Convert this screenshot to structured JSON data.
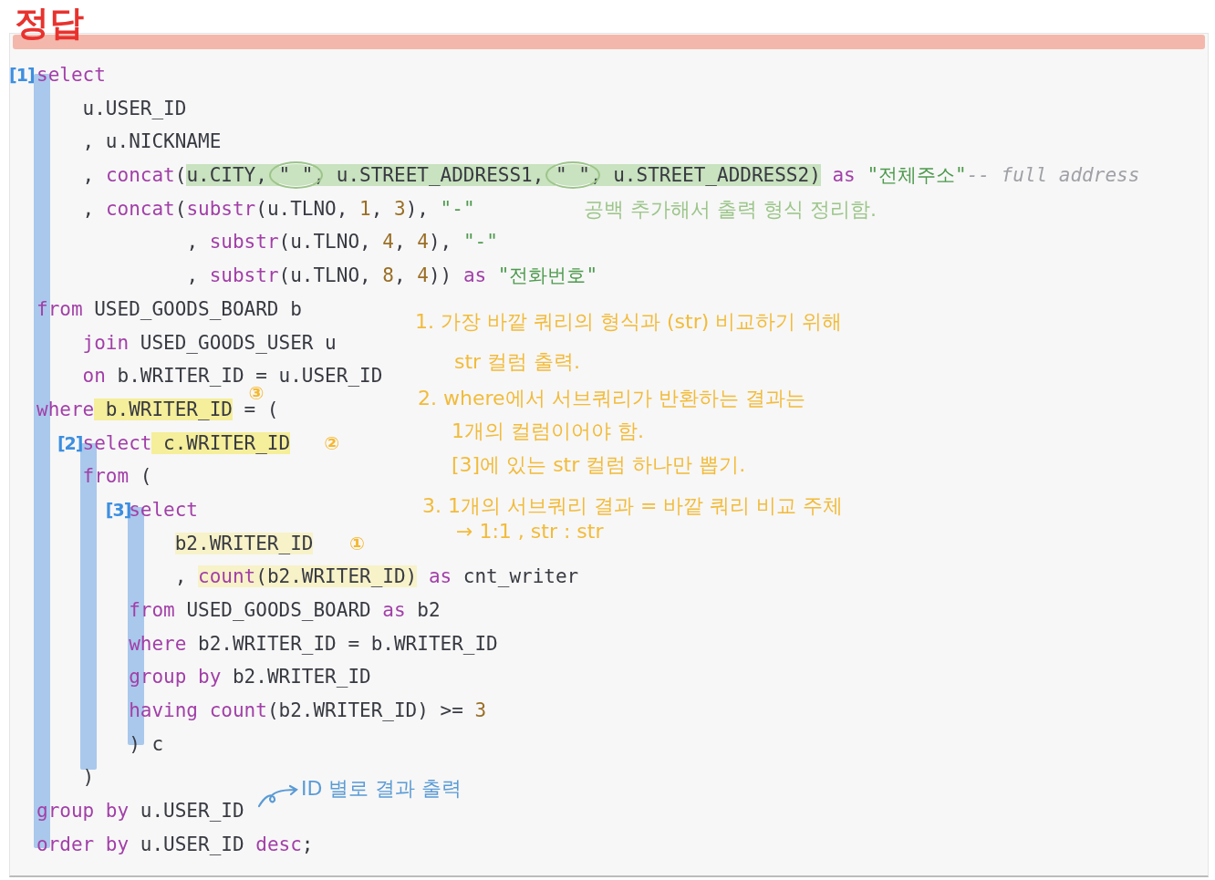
{
  "title": "정답",
  "lines": [
    {
      "label": "[1]",
      "tokens": [
        {
          "text": "select",
          "kind": "keyword"
        }
      ]
    },
    {
      "tokens": [
        {
          "text": "    u.USER_ID",
          "kind": "plain"
        }
      ]
    },
    {
      "tokens": [
        {
          "text": "    , u.NICKNAME",
          "kind": "plain"
        }
      ]
    },
    {
      "tokens": [
        {
          "text": "    , ",
          "kind": "plain",
          "circled": false
        },
        {
          "text": "concat",
          "kind": "function",
          "circled": false
        },
        {
          "text": "(",
          "kind": "plain",
          "circled": false
        },
        {
          "text": "u.CITY, ",
          "kind": "plain",
          "color": "#c9e2bf",
          "circled": false
        },
        {
          "text": "\" \"",
          "kind": "plain",
          "color": "#c9e2bf",
          "circled": true
        },
        {
          "text": ", u.STREET_ADDRESS1, ",
          "kind": "plain",
          "color": "#c9e2bf",
          "circled": false
        },
        {
          "text": "\" \"",
          "kind": "plain",
          "color": "#c9e2bf",
          "circled": true
        },
        {
          "text": ", u.STREET_ADDRESS2)",
          "kind": "plain",
          "color": "#c9e2bf",
          "circled": false
        },
        {
          "text": " as",
          "kind": "keyword",
          "circled": false
        },
        {
          "text": " \"전체주소\"",
          "kind": "string",
          "circled": false
        },
        {
          "text": "-- full address",
          "kind": "comment",
          "circled": false
        }
      ]
    },
    {
      "tokens": [
        {
          "text": "    , ",
          "kind": "plain"
        },
        {
          "text": "concat",
          "kind": "function"
        },
        {
          "text": "(",
          "kind": "plain"
        },
        {
          "text": "substr",
          "kind": "function"
        },
        {
          "text": "(u.TLNO, ",
          "kind": "plain"
        },
        {
          "text": "1",
          "kind": "number"
        },
        {
          "text": ", ",
          "kind": "plain"
        },
        {
          "text": "3",
          "kind": "number"
        },
        {
          "text": "), ",
          "kind": "plain"
        },
        {
          "text": "\"-\"",
          "kind": "string"
        }
      ]
    },
    {
      "tokens": [
        {
          "text": "             , ",
          "kind": "plain"
        },
        {
          "text": "substr",
          "kind": "function"
        },
        {
          "text": "(u.TLNO, ",
          "kind": "plain"
        },
        {
          "text": "4",
          "kind": "number"
        },
        {
          "text": ", ",
          "kind": "plain"
        },
        {
          "text": "4",
          "kind": "number"
        },
        {
          "text": "), ",
          "kind": "plain"
        },
        {
          "text": "\"-\"",
          "kind": "string"
        }
      ]
    },
    {
      "tokens": [
        {
          "text": "             , ",
          "kind": "plain"
        },
        {
          "text": "substr",
          "kind": "function"
        },
        {
          "text": "(u.TLNO, ",
          "kind": "plain"
        },
        {
          "text": "8",
          "kind": "number"
        },
        {
          "text": ", ",
          "kind": "plain"
        },
        {
          "text": "4",
          "kind": "number"
        },
        {
          "text": ")) ",
          "kind": "plain"
        },
        {
          "text": "as",
          "kind": "keyword"
        },
        {
          "text": " \"전화번호\"",
          "kind": "string"
        }
      ]
    },
    {
      "tokens": [
        {
          "text": "from",
          "kind": "keyword"
        },
        {
          "text": " USED_GOODS_BOARD b",
          "kind": "plain"
        }
      ]
    },
    {
      "tokens": [
        {
          "text": "    join",
          "kind": "keyword"
        },
        {
          "text": " USED_GOODS_USER u",
          "kind": "plain"
        }
      ]
    },
    {
      "tokens": [
        {
          "text": "    on",
          "kind": "keyword"
        },
        {
          "text": " b.WRITER_ID = u.USER_ID",
          "kind": "plain"
        }
      ]
    },
    {
      "tokens": [
        {
          "text": "where",
          "kind": "keyword"
        },
        {
          "text": " b.WRITER_ID",
          "kind": "plain",
          "color": "#f5ee9a",
          "mark": {
            "text": "③",
            "raised": true
          }
        },
        {
          "text": " = (",
          "kind": "plain"
        }
      ]
    },
    {
      "label": "[2]",
      "tokens": [
        {
          "text": "    select",
          "kind": "keyword"
        },
        {
          "text": " c.WRITER_ID",
          "kind": "plain",
          "color": "#f5ee9a",
          "mark": {
            "text": "②"
          }
        }
      ]
    },
    {
      "tokens": [
        {
          "text": "    from",
          "kind": "keyword"
        },
        {
          "text": " (",
          "kind": "plain"
        }
      ]
    },
    {
      "label": "[3]",
      "tokens": [
        {
          "text": "        select",
          "kind": "keyword"
        }
      ]
    },
    {
      "tokens": [
        {
          "text": "            b2.WRITER_ID",
          "kind": "plain",
          "color": "#f7f2c8",
          "mark": {
            "text": "①"
          }
        }
      ]
    },
    {
      "tokens": [
        {
          "text": "            , ",
          "kind": "plain"
        },
        {
          "text": "count",
          "kind": "function",
          "color": "#f7f2c8"
        },
        {
          "text": "(b2.WRITER_ID)",
          "kind": "plain",
          "color": "#f7f2c8"
        },
        {
          "text": " as",
          "kind": "keyword"
        },
        {
          "text": " cnt_writer",
          "kind": "plain"
        }
      ]
    },
    {
      "tokens": [
        {
          "text": "        from",
          "kind": "keyword"
        },
        {
          "text": " USED_GOODS_BOARD ",
          "kind": "plain"
        },
        {
          "text": "as",
          "kind": "keyword"
        },
        {
          "text": " b2",
          "kind": "plain"
        }
      ]
    },
    {
      "tokens": [
        {
          "text": "        where",
          "kind": "keyword"
        },
        {
          "text": " b2.WRITER_ID = b.WRITER_ID",
          "kind": "plain"
        }
      ]
    },
    {
      "tokens": [
        {
          "text": "        group by",
          "kind": "keyword"
        },
        {
          "text": " b2.WRITER_ID",
          "kind": "plain"
        }
      ]
    },
    {
      "tokens": [
        {
          "text": "        having",
          "kind": "keyword"
        },
        {
          "text": " count",
          "kind": "function"
        },
        {
          "text": "(b2.WRITER_ID) >= ",
          "kind": "plain"
        },
        {
          "text": "3",
          "kind": "number"
        }
      ]
    },
    {
      "tokens": [
        {
          "text": "        ) c",
          "kind": "plain"
        }
      ]
    },
    {
      "tokens": [
        {
          "text": "    )",
          "kind": "plain"
        }
      ]
    },
    {
      "tokens": [
        {
          "text": "group by",
          "kind": "keyword"
        },
        {
          "text": " u.USER_ID",
          "kind": "plain"
        }
      ]
    },
    {
      "tokens": [
        {
          "text": "order by",
          "kind": "keyword"
        },
        {
          "text": " u.USER_ID ",
          "kind": "plain"
        },
        {
          "text": "desc",
          "kind": "keyword"
        },
        {
          "text": ";",
          "kind": "plain"
        }
      ]
    }
  ],
  "notes": [
    {
      "kind": "note",
      "color": "#9cc58a",
      "text": "공백 추가해서 출력 형식 정리함."
    },
    {
      "kind": "note",
      "color": "#f2bb3a",
      "text": "1. 가장 바깥 쿼리의 형식과 (str) 비교하기 위해"
    },
    {
      "kind": "note",
      "color": "#f2bb3a",
      "text": "str 컬럼 출력."
    },
    {
      "kind": "note",
      "color": "#f2bb3a",
      "text": "2. where에서 서브쿼리가 반환하는 결과는"
    },
    {
      "kind": "note",
      "color": "#f2bb3a",
      "text": "1개의 컬럼이어야 함."
    },
    {
      "kind": "note",
      "color": "#f2bb3a",
      "text": "[3]에 있는 str 컬럼 하나만 뽑기."
    },
    {
      "kind": "note",
      "color": "#f2bb3a",
      "text": "3. 1개의 서브쿼리 결과 = 바깥 쿼리 비교 주체"
    },
    {
      "kind": "note",
      "color": "#f2bb3a",
      "text": "→ 1:1 , str : str"
    },
    {
      "kind": "arrow_note",
      "color": "#5b9bd5",
      "text": "ID 별로 결과 출력"
    }
  ]
}
